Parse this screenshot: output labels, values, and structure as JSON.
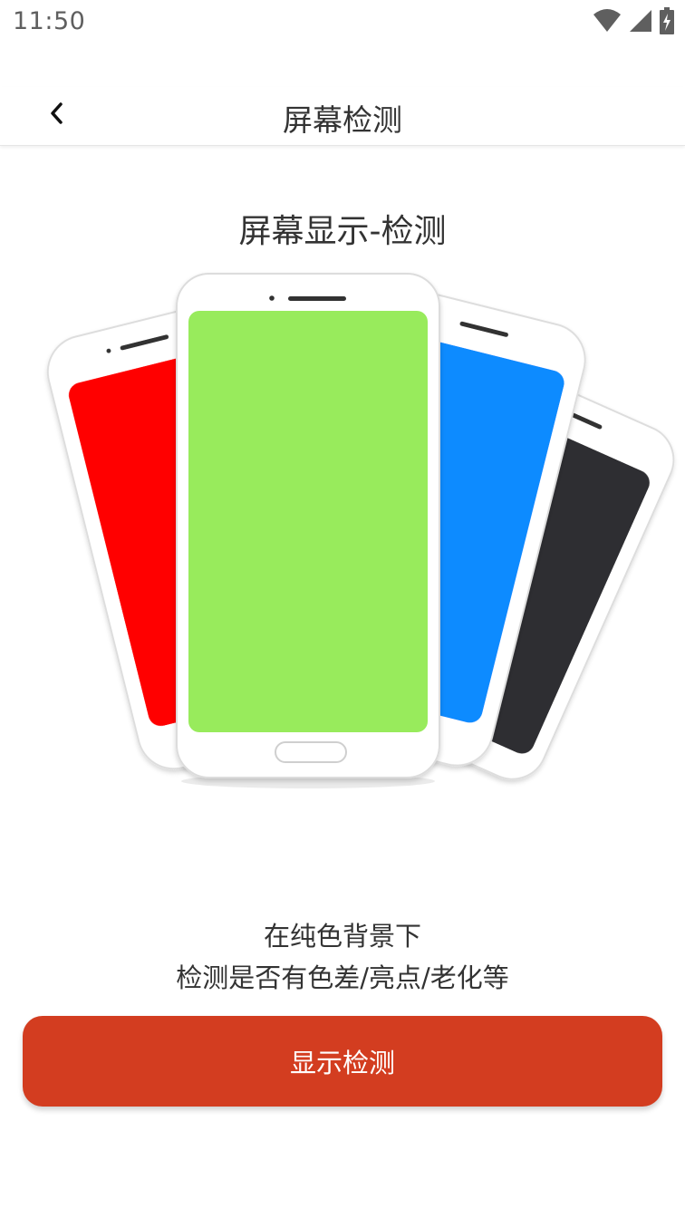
{
  "status_bar": {
    "time": "11:50",
    "icons": [
      "wifi-icon",
      "cellular-signal-icon",
      "battery-charging-icon"
    ]
  },
  "nav": {
    "back_icon": "chevron-left-icon",
    "title": "屏幕检测"
  },
  "hero": {
    "title": "屏幕显示-检测"
  },
  "illustration": {
    "phone_screen_colors": [
      "#ff0000",
      "#98eb5c",
      "#0a8bff",
      "#2f2e30"
    ]
  },
  "description": {
    "line1": "在纯色背景下",
    "line2": "检测是否有色差/亮点/老化等"
  },
  "action": {
    "label": "显示检测",
    "color": "#d33d20"
  }
}
